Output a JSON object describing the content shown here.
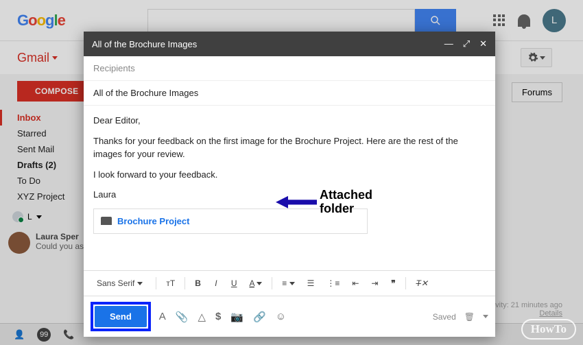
{
  "header": {
    "avatar_initial": "L"
  },
  "gmail_label": "Gmail",
  "compose_button": "COMPOSE",
  "sidebar": {
    "items": [
      {
        "label": "Inbox",
        "active": true
      },
      {
        "label": "Starred"
      },
      {
        "label": "Sent Mail"
      },
      {
        "label": "Drafts (2)",
        "bold": true
      },
      {
        "label": "To Do"
      },
      {
        "label": "XYZ Project"
      }
    ],
    "more": "L"
  },
  "forums_label": "Forums",
  "conversation": {
    "name": "Laura Sper",
    "preview": "Could you as"
  },
  "compose": {
    "title": "All of the Brochure Images",
    "recipients_placeholder": "Recipients",
    "subject": "All of the Brochure Images",
    "body_p1": "Dear Editor,",
    "body_p2": "Thanks for your feedback on the first image for the Brochure Project. Here are the rest of the images for your review.",
    "body_p3": "I look forward to your feedback.",
    "signature": "Laura",
    "attachment_name": "Brochure Project",
    "font": "Sans Serif",
    "send": "Send",
    "saved": "Saved"
  },
  "annotation": {
    "line1": "Attached",
    "line2": "folder"
  },
  "activity": {
    "line1": "vity: 21 minutes ago",
    "line2": "Details"
  },
  "watermark": "HowTo"
}
